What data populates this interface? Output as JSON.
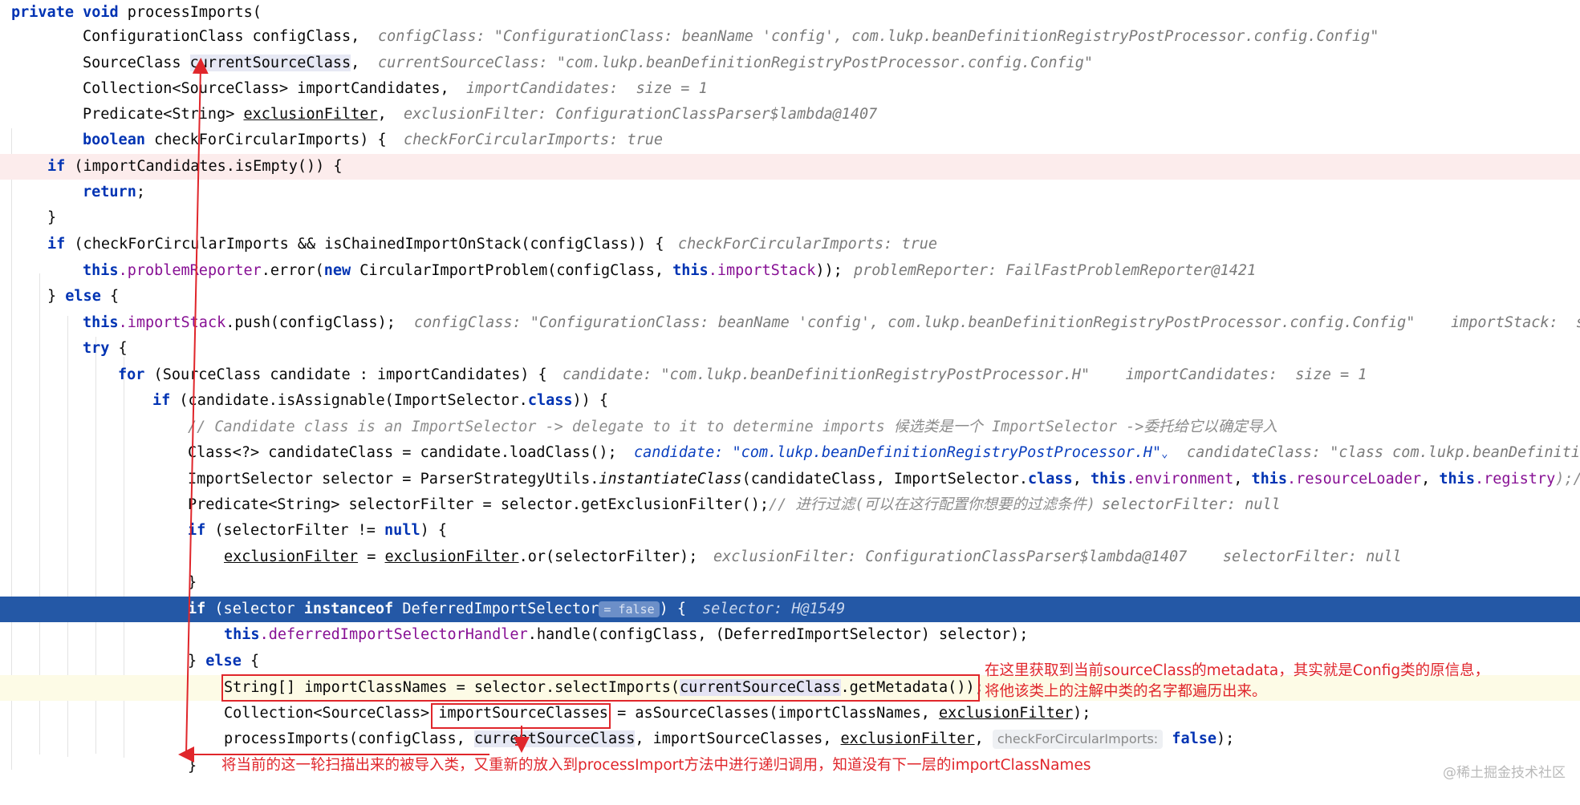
{
  "editor": {
    "lines": {
      "l0": {
        "kw1": "private void",
        "t1": " processImports("
      },
      "l1": {
        "code": "ConfigurationClass configClass,",
        "hint": "configClass: \"ConfigurationClass: beanName 'config', com.lukp.beanDefinitionRegistryPostProcessor.config.Config\""
      },
      "l2": {
        "a": "SourceClass ",
        "b": "currentSourceClass",
        ",": ",",
        "hint": "currentSourceClass: \"com.lukp.beanDefinitionRegistryPostProcessor.config.Config\""
      },
      "l3": {
        "code": "Collection<SourceClass> importCandidates,",
        "hint": "importCandidates:  size = 1"
      },
      "l4": {
        "a": "Predicate<String> ",
        "b": "exclusionFilter",
        ",": ",",
        "hint": "exclusionFilter: ConfigurationClassParser$lambda@1407"
      },
      "l5": {
        "kw": "boolean",
        "t": " checkForCircularImports) {",
        "hint": "checkForCircularImports: true"
      },
      "l6": {
        "kw": "if",
        "t": " (importCandidates.isEmpty()) {"
      },
      "l7": {
        "kw": "return",
        "t": ";"
      },
      "l8": {
        "t": "}"
      },
      "l9": {
        "kw": "if",
        "t": " (checkForCircularImports && isChainedImportOnStack(configClass)) {",
        "hint": "checkForCircularImports: true"
      },
      "l10": {
        "kw1": "this",
        "f1": ".problemReporter",
        "t1": ".error(",
        "kw2": "new",
        "t2": " CircularImportProblem(configClass, ",
        "kw3": "this",
        "f2": ".importStack",
        "t3": "));",
        "hint": "problemReporter: FailFastProblemReporter@1421"
      },
      "l11": {
        "t1": "} ",
        "kw": "else",
        "t2": " {"
      },
      "l12": {
        "kw": "this",
        "f": ".importStack",
        "t": ".push(configClass);",
        "hint": "configClass: \"ConfigurationClass: beanName 'config', com.lukp.beanDefinitionRegistryPostProcessor.config.Config\"    importStack:  size"
      },
      "l13": {
        "kw": "try",
        "t": " {"
      },
      "l14": {
        "kw": "for",
        "t": " (SourceClass candidate : importCandidates) {",
        "hint": "candidate: \"com.lukp.beanDefinitionRegistryPostProcessor.H\"    importCandidates:  size = 1"
      },
      "l15": {
        "kw1": "if",
        "t1": " (candidate.isAssignable(ImportSelector.",
        "kw2": "class",
        "t2": ")) {"
      },
      "l16": {
        "cm": "// Candidate class is an ImportSelector -> delegate to it to determine imports 候选类是一个 ImportSelector ->委托给它以确定导入"
      },
      "l17": {
        "t": "Class<?> candidateClass = candidate.loadClass();",
        "hint": "candidate: \"com.lukp.beanDefinitionRegistryPostProcessor.H\"",
        "chev": "⌄",
        "hint2": "candidateClass: \"class com.lukp.beanDefinitio"
      },
      "l18": {
        "t1": "ImportSelector selector = ParserStrategyUtils.",
        "it": "instantiateClass",
        "t2": "(candidateClass, ImportSelector.",
        "kw1": "class",
        ",": ", ",
        "kw2": "this",
        "f1": ".environment",
        "c2": ", ",
        "kw3": "this",
        "f2": ".resourceLoader",
        "c3": ", ",
        "kw4": "this",
        "f3": ".registry",
        "t3": ");//"
      },
      "l19": {
        "t": "Predicate<String> selectorFilter = selector.getExclusionFilter();",
        "cm": "// 进行过滤(可以在这行配置你想要的过滤条件)",
        "hint": "selectorFilter: null"
      },
      "l20": {
        "kw1": "if",
        "t1": " (selectorFilter != ",
        "kw2": "null",
        "t2": ") {"
      },
      "l21": {
        "u1": "exclusionFilter",
        "t1": " = ",
        "u2": "exclusionFilter",
        "t2": ".or(selectorFilter);",
        "hint": "exclusionFilter: ConfigurationClassParser$lambda@1407    selectorFilter: null"
      },
      "l22": {
        "t": "}"
      },
      "l23": {
        "kw1": "if",
        "t1": " (selector ",
        "kw2": "instanceof",
        "t2": " DeferredImportSelector",
        "inlay": "= false",
        "t3": ") {",
        "hint": "selector: H@1549"
      },
      "l24": {
        "kw": "this",
        "f": ".deferredImportSelectorHandler",
        "t": ".handle(configClass, (DeferredImportSelector) selector);"
      },
      "l25": {
        "t1": "} ",
        "kw": "else",
        "t2": " {"
      },
      "l26": {
        "a": "String[] importClassNames = selector.selectImports(",
        "b": "currentSourceClass",
        "c": ".getMetadata());"
      },
      "l27": {
        "a": "Collection<SourceClass> ",
        "b": "importSourceClasses",
        "c": " = asSourceClasses(importClassNames, ",
        "u": "exclusionFilter",
        "d": ");"
      },
      "l28": {
        "a": "processImports(configClass, ",
        "b": "currentSourceClass",
        "c": ", importSourceClasses, ",
        "u": "exclusionFilter",
        "d": ", ",
        "inlay": "checkForCircularImports:",
        "kw": "false",
        "e": ");"
      },
      "l29": {
        "t": "}"
      }
    }
  },
  "annotations": {
    "note1_line1": "在这里获取到当前sourceClass的metadata，其实就是Config类的原信息，",
    "note1_line2": "将他该类上的注解中类的名字都遍历出来。",
    "note2": "将当前的这一轮扫描出来的被导入类，又重新的放入到processImport方法中进行递归调用，知道没有下一层的importClassNames"
  },
  "watermark": "@稀土掘金技术社区",
  "colors": {
    "keyword": "#0033b3",
    "field": "#871094",
    "selection": "#2458a6",
    "annotation": "#e0262b",
    "hint": "#7a7a7a"
  }
}
